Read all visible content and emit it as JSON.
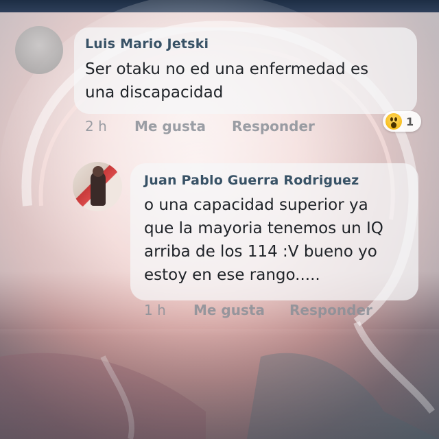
{
  "comments": [
    {
      "author": "Luis Mario Jetski",
      "text": "Ser otaku no ed una enfermedad es\nuna discapacidad",
      "time": "2 h",
      "like_label": "Me gusta",
      "reply_label": "Responder",
      "reaction": {
        "icon": "wow-icon",
        "count": "1"
      },
      "avatar": "default-avatar"
    },
    {
      "author": "Juan Pablo Guerra Rodriguez",
      "text": "o una capacidad superior ya\nque la mayoria tenemos un IQ\narriba de los 114 :V  bueno yo\nestoy en ese rango.....",
      "time": "1 h",
      "like_label": "Me gusta",
      "reply_label": "Responder",
      "avatar": "profile-photo"
    }
  ],
  "colors": {
    "author": "#385266",
    "meta": "#8a9098",
    "top_bar": "#1d2d44"
  }
}
